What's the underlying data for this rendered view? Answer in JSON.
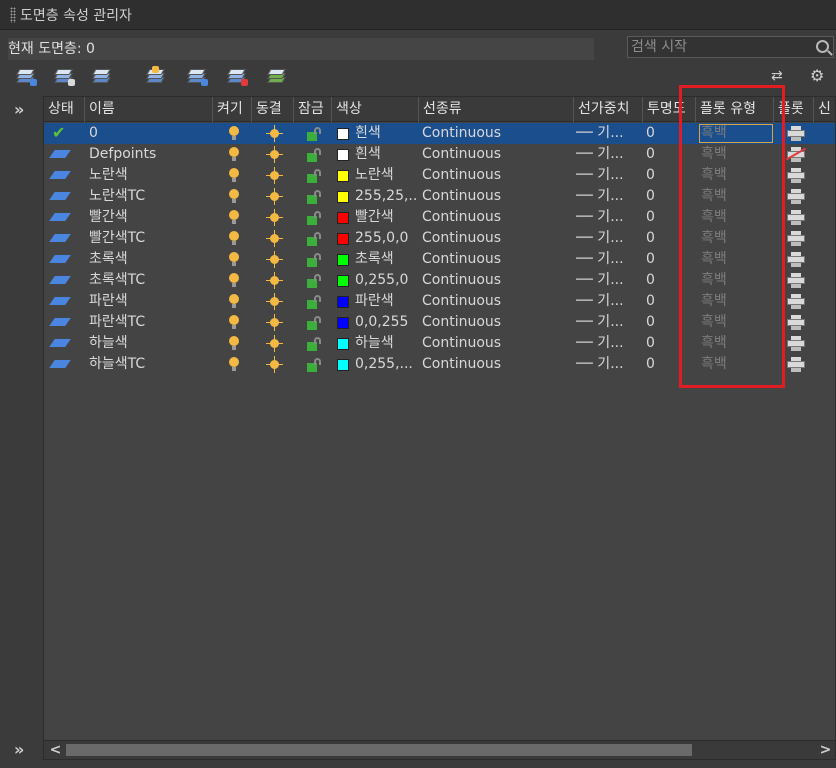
{
  "window": {
    "title": "도면층 속성 관리자"
  },
  "status": {
    "current_layer": "현재 도면층: 0"
  },
  "search": {
    "placeholder": "검색 시작"
  },
  "columns": [
    "상태",
    "이름",
    "켜기",
    "동결",
    "잠금",
    "색상",
    "선종류",
    "선가중치",
    "투명도",
    "플롯 유형",
    "플롯",
    "신"
  ],
  "layers": [
    {
      "name": "0",
      "color_label": "흰색",
      "color_hex": "#ffffff",
      "linetype": "Continuous",
      "lineweight": "── 기...",
      "transparency": "0",
      "plot_style": "흑백",
      "current": true,
      "plot": true
    },
    {
      "name": "Defpoints",
      "color_label": "흰색",
      "color_hex": "#ffffff",
      "linetype": "Continuous",
      "lineweight": "── 기...",
      "transparency": "0",
      "plot_style": "흑백",
      "current": false,
      "plot": false
    },
    {
      "name": "노란색",
      "color_label": "노란색",
      "color_hex": "#ffff00",
      "linetype": "Continuous",
      "lineweight": "── 기...",
      "transparency": "0",
      "plot_style": "흑백",
      "current": false,
      "plot": true
    },
    {
      "name": "노란색TC",
      "color_label": "255,25,...",
      "color_hex": "#ffff00",
      "linetype": "Continuous",
      "lineweight": "── 기...",
      "transparency": "0",
      "plot_style": "흑백",
      "current": false,
      "plot": true
    },
    {
      "name": "빨간색",
      "color_label": "빨간색",
      "color_hex": "#ff0000",
      "linetype": "Continuous",
      "lineweight": "── 기...",
      "transparency": "0",
      "plot_style": "흑백",
      "current": false,
      "plot": true
    },
    {
      "name": "빨간색TC",
      "color_label": "255,0,0",
      "color_hex": "#ff0000",
      "linetype": "Continuous",
      "lineweight": "── 기...",
      "transparency": "0",
      "plot_style": "흑백",
      "current": false,
      "plot": true
    },
    {
      "name": "초록색",
      "color_label": "초록색",
      "color_hex": "#00ff00",
      "linetype": "Continuous",
      "lineweight": "── 기...",
      "transparency": "0",
      "plot_style": "흑백",
      "current": false,
      "plot": true
    },
    {
      "name": "초록색TC",
      "color_label": "0,255,0",
      "color_hex": "#00ff00",
      "linetype": "Continuous",
      "lineweight": "── 기...",
      "transparency": "0",
      "plot_style": "흑백",
      "current": false,
      "plot": true
    },
    {
      "name": "파란색",
      "color_label": "파란색",
      "color_hex": "#0000ff",
      "linetype": "Continuous",
      "lineweight": "── 기...",
      "transparency": "0",
      "plot_style": "흑백",
      "current": false,
      "plot": true
    },
    {
      "name": "파란색TC",
      "color_label": "0,0,255",
      "color_hex": "#0000ff",
      "linetype": "Continuous",
      "lineweight": "── 기...",
      "transparency": "0",
      "plot_style": "흑백",
      "current": false,
      "plot": true
    },
    {
      "name": "하늘색",
      "color_label": "하늘색",
      "color_hex": "#00ffff",
      "linetype": "Continuous",
      "lineweight": "── 기...",
      "transparency": "0",
      "plot_style": "흑백",
      "current": false,
      "plot": true
    },
    {
      "name": "하늘색TC",
      "color_label": "0,255,...",
      "color_hex": "#00ffff",
      "linetype": "Continuous",
      "lineweight": "── 기...",
      "transparency": "0",
      "plot_style": "흑백",
      "current": false,
      "plot": true
    }
  ],
  "icons": {
    "expand": "»",
    "refresh": "⇄",
    "settings": "⚙",
    "check": "✔",
    "scroll_left": "<",
    "scroll_right": ">"
  },
  "colors": {
    "selected_row": "#1b4e8c",
    "highlight": "#e31b23"
  }
}
